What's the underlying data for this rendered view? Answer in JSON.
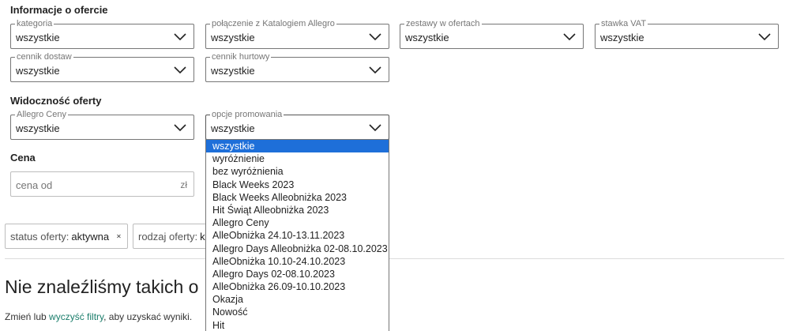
{
  "offer_info": {
    "title": "Informacje o ofercie",
    "fields": [
      {
        "label": "kategoria",
        "value": "wszystkie"
      },
      {
        "label": "połączenie z Katalogiem Allegro",
        "value": "wszystkie"
      },
      {
        "label": "zestawy w ofertach",
        "value": "wszystkie"
      },
      {
        "label": "stawka VAT",
        "value": "wszystkie"
      },
      {
        "label": "cennik dostaw",
        "value": "wszystkie"
      },
      {
        "label": "cennik hurtowy",
        "value": "wszystkie"
      }
    ]
  },
  "visibility": {
    "title": "Widoczność oferty",
    "fields": [
      {
        "label": "Allegro Ceny",
        "value": "wszystkie"
      },
      {
        "label": "opcje promowania",
        "value": "wszystkie"
      }
    ]
  },
  "price": {
    "title": "Cena",
    "from_placeholder": "cena od",
    "unit": "zł"
  },
  "filters_chips": [
    {
      "key": "status oferty:",
      "value": "aktywna",
      "icon": "close-icon"
    },
    {
      "key": "rodzaj oferty:",
      "value": "ku",
      "icon": ""
    }
  ],
  "empty_state": {
    "heading": "Nie znaleźliśmy takich o",
    "hint_before": "Zmień lub ",
    "hint_link": "wyczyść filtry",
    "hint_after": ", aby uzyskać wyniki."
  },
  "promo_dropdown": {
    "selected_index": 0,
    "options": [
      "wszystkie",
      "wyróżnienie",
      "bez wyróżnienia",
      "Black Weeks 2023",
      "Black Weeks Alleobniżka 2023",
      "Hit Świąt Alleobniżka 2023",
      "Allegro Ceny",
      "AlleObniżka 24.10-13.11.2023",
      "Allegro Days Alleobniżka 02-08.10.2023",
      "AlleObniżka 10.10-24.10.2023",
      "Allegro Days 02-08.10.2023",
      "AlleObniżka 26.09-10.10.2023",
      "Okazja",
      "Nowość",
      "Hit"
    ]
  },
  "colors": {
    "accent": "#1e6fd9",
    "link": "#1a7d6b",
    "border": "#767676"
  }
}
